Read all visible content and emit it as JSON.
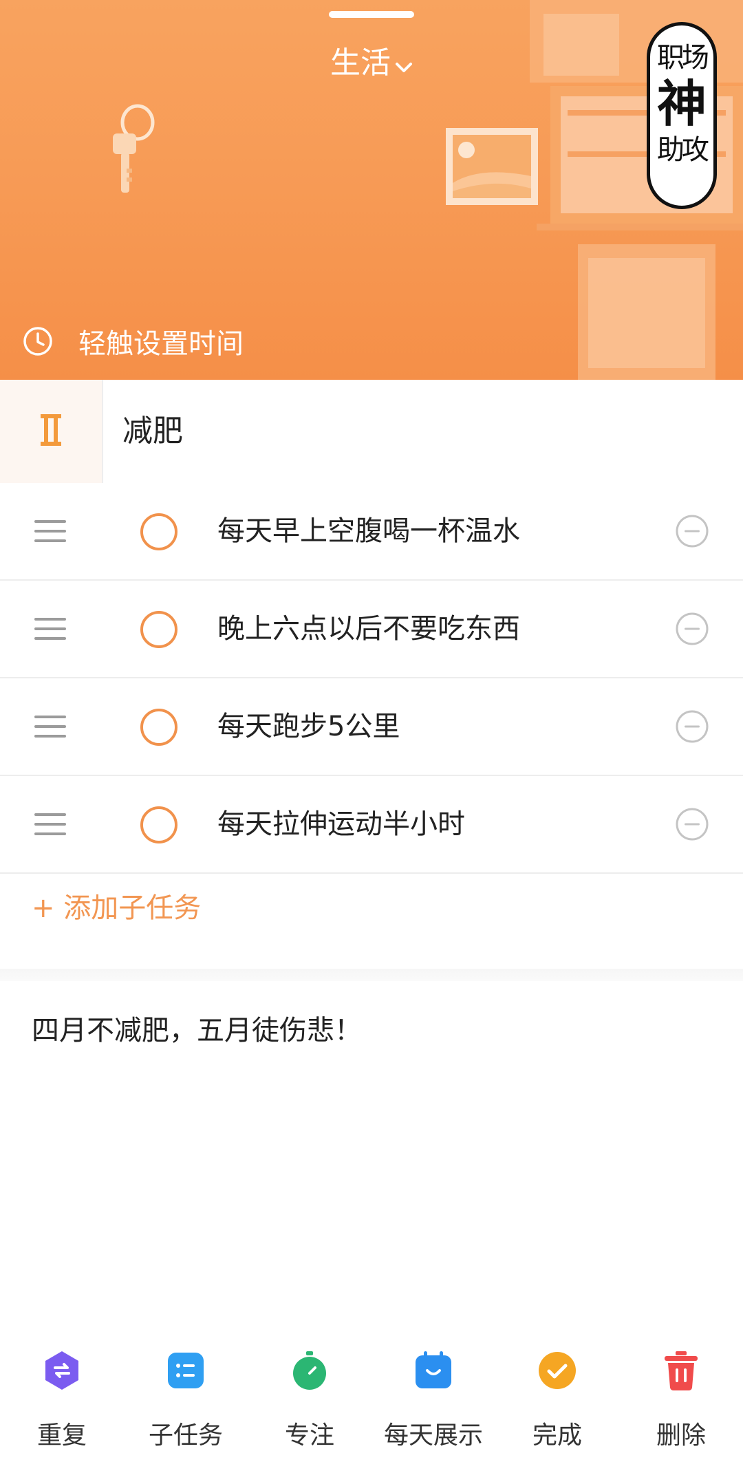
{
  "header": {
    "category": "生活",
    "time_setting": "轻触设置时间",
    "stamp_lines": [
      "职场",
      "神",
      "助攻"
    ]
  },
  "task": {
    "priority_icon": "roman-two-priority-icon",
    "title": "减肥"
  },
  "subtasks": [
    {
      "text": "每天早上空腹喝一杯温水",
      "done": false
    },
    {
      "text": "晚上六点以后不要吃东西",
      "done": false
    },
    {
      "text": "每天跑步5公里",
      "done": false
    },
    {
      "text": "每天拉伸运动半小时",
      "done": false
    }
  ],
  "add_subtask_label": "+ 添加子任务",
  "note": "四月不减肥，五月徒伤悲！",
  "toolbar": [
    {
      "label": "重复",
      "icon": "repeat-icon",
      "color": "#7b5cf0"
    },
    {
      "label": "子任务",
      "icon": "subtask-list-icon",
      "color": "#2f9ff2"
    },
    {
      "label": "专注",
      "icon": "stopwatch-icon",
      "color": "#2bb673"
    },
    {
      "label": "每天展示",
      "icon": "calendar-icon",
      "color": "#2b8ff0"
    },
    {
      "label": "完成",
      "icon": "check-circle-icon",
      "color": "#f5a623"
    },
    {
      "label": "删除",
      "icon": "trash-icon",
      "color": "#f04b4b"
    }
  ],
  "colors": {
    "accent": "#f1924c",
    "header_bg": "#f79a55"
  }
}
